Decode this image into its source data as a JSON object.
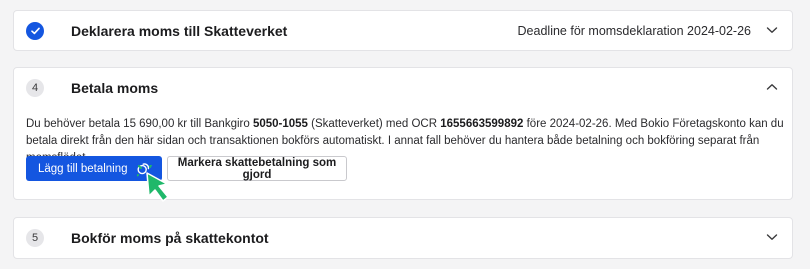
{
  "steps": [
    {
      "number": "",
      "title": "Deklarera moms till Skatteverket",
      "deadline": "Deadline för momsdeklaration 2024-02-26",
      "completed": true,
      "expanded": false
    },
    {
      "number": "4",
      "title": "Betala moms",
      "completed": false,
      "expanded": true,
      "body": {
        "seg1": "Du behöver betala 15 690,00 kr till Bankgiro ",
        "bankgiro": "5050-1055",
        "seg2": " (Skatteverket) med OCR ",
        "ocr": "1655663599892",
        "seg3": " före 2024-02-26. Med Bokio Företagskonto kan du betala direkt från den här sidan och transaktionen bokförs automatiskt. I annat fall behöver du hantera både betalning och bokföring separat från momsflödet."
      },
      "buttons": {
        "primary": "Lägg till betalning",
        "secondary": "Markera skattebetalning som gjord"
      }
    },
    {
      "number": "5",
      "title": "Bokför moms på skattekontot",
      "completed": false,
      "expanded": false
    }
  ],
  "icons": {
    "check": "check-icon",
    "coin": "coin-icon",
    "chevron_down": "chevron-down-icon",
    "chevron_up": "chevron-up-icon",
    "cursor": "pointer-cursor-icon"
  },
  "colors": {
    "primary": "#1456e0",
    "cursor": "#1fb86a",
    "background": "#f4f4f5"
  }
}
